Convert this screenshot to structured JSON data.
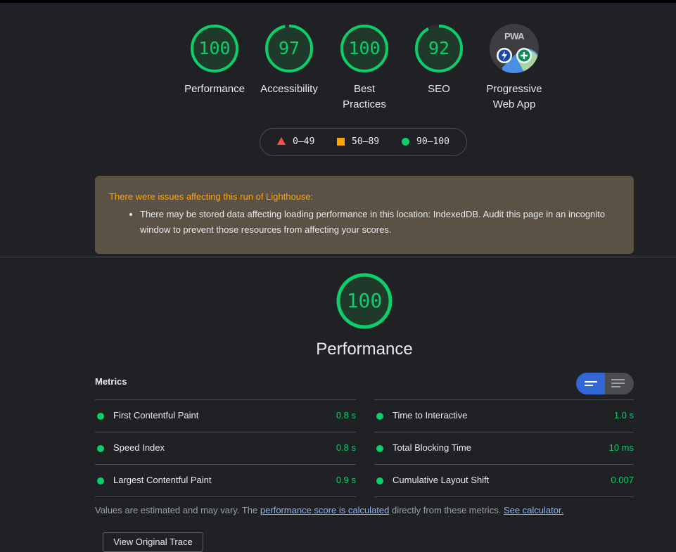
{
  "gauges": [
    {
      "score": "100",
      "label": "Performance"
    },
    {
      "score": "97",
      "label": "Accessibility",
      "fraction": 0.97
    },
    {
      "score": "100",
      "label": "Best Practices"
    },
    {
      "score": "92",
      "label": "SEO",
      "fraction": 0.92
    }
  ],
  "pwa": {
    "badge_text": "PWA",
    "label": "Progressive Web App"
  },
  "legend": [
    {
      "shape": "triangle",
      "range": "0–49",
      "color": "#ff4e42"
    },
    {
      "shape": "square",
      "range": "50–89",
      "color": "#ffa400"
    },
    {
      "shape": "circle",
      "range": "90–100",
      "color": "#0cce6b"
    }
  ],
  "warning": {
    "title": "There were issues affecting this run of Lighthouse:",
    "items": [
      "There may be stored data affecting loading performance in this location: IndexedDB. Audit this page in an incognito window to prevent those resources from affecting your scores."
    ]
  },
  "performance": {
    "score": "100",
    "title": "Performance"
  },
  "metrics": {
    "header": "Metrics",
    "left": [
      {
        "name": "First Contentful Paint",
        "value": "0.8 s"
      },
      {
        "name": "Speed Index",
        "value": "0.8 s"
      },
      {
        "name": "Largest Contentful Paint",
        "value": "0.9 s"
      }
    ],
    "right": [
      {
        "name": "Time to Interactive",
        "value": "1.0 s"
      },
      {
        "name": "Total Blocking Time",
        "value": "10 ms"
      },
      {
        "name": "Cumulative Layout Shift",
        "value": "0.007"
      }
    ]
  },
  "note": {
    "prefix": "Values are estimated and may vary. The ",
    "link1": "performance score is calculated",
    "middle": " directly from these metrics. ",
    "link2": "See calculator."
  },
  "trace_button": "View Original Trace",
  "colors": {
    "pass": "#0cce6b",
    "average": "#ffa400",
    "fail": "#ff4e42",
    "background": "#202124"
  }
}
